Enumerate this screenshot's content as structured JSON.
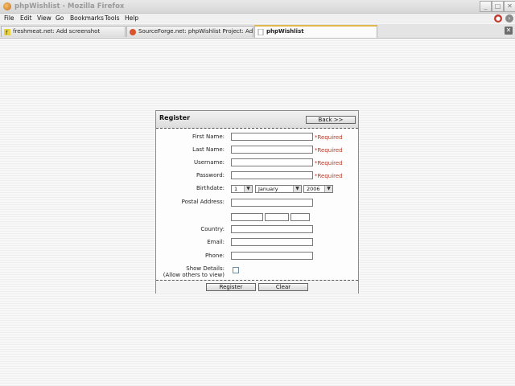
{
  "window": {
    "title": "phpWishlist - Mozilla Firefox",
    "controls": {
      "minimize": "_",
      "maximize": "□",
      "close": "✕"
    }
  },
  "menu": {
    "items": [
      {
        "label": "File"
      },
      {
        "label": "Edit"
      },
      {
        "label": "View"
      },
      {
        "label": "Go"
      },
      {
        "label": "Bookmarks"
      },
      {
        "label": "Tools"
      },
      {
        "label": "Help"
      }
    ]
  },
  "tabs": [
    {
      "label": "freshmeat.net: Add screenshot",
      "icon": "freshmeat-icon"
    },
    {
      "label": "SourceForge.net: phpWishlist Project: Admi...",
      "icon": "sourceforge-icon"
    },
    {
      "label": "phpWishlist",
      "icon": "page-icon",
      "active": true
    }
  ],
  "form": {
    "title": "Register",
    "back_label": "Back >>",
    "required_text": "*Required",
    "fields": {
      "first_name": "First Name:",
      "last_name": "Last Name:",
      "username": "Username:",
      "password": "Password:",
      "birthdate": "Birthdate:",
      "postal_address": "Postal Address:",
      "country": "Country:",
      "email": "Email:",
      "phone": "Phone:",
      "show_details": "Show Details:",
      "show_details_hint": "(Allow others to view)"
    },
    "birthdate": {
      "day": "1",
      "month": "January",
      "year": "2006"
    },
    "register_label": "Register",
    "clear_label": "Clear"
  },
  "colors": {
    "required": "#b23a2a",
    "active_tab_accent": "#e2b64a"
  }
}
